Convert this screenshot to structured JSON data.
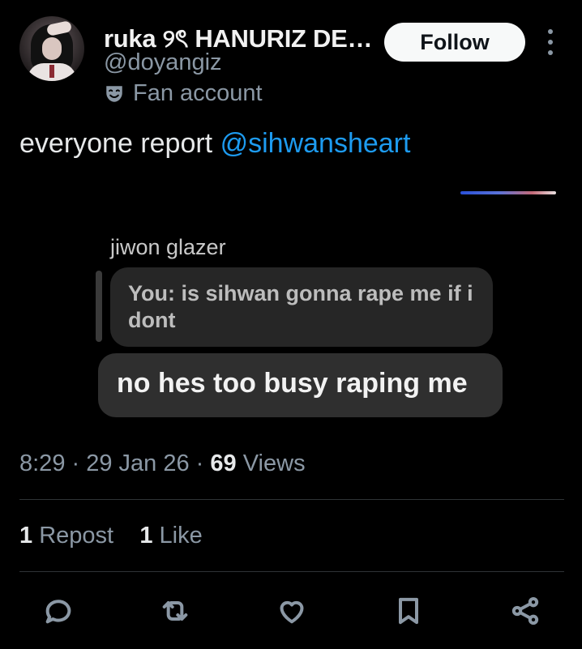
{
  "author": {
    "display_name": "ruka ୨ৎ HANURIZ DE…",
    "handle": "@doyangiz",
    "label": "Fan account"
  },
  "header": {
    "follow_label": "Follow"
  },
  "tweet": {
    "text_before": "everyone report ",
    "mention": "@sihwansheart"
  },
  "screenshot": {
    "chat_name": "jiwon glazer",
    "quoted_message": "You: is sihwan gonna rape me if i dont",
    "message": "no hes too busy raping me"
  },
  "meta": {
    "time": "8:29",
    "date": "29 Jan 26",
    "views_count": "69",
    "views_label": "Views"
  },
  "stats": {
    "reposts_count": "1",
    "reposts_label": "Repost",
    "likes_count": "1",
    "likes_label": "Like"
  },
  "actions": [
    "reply-icon",
    "repost-icon",
    "like-icon",
    "bookmark-icon",
    "share-icon"
  ],
  "colors": {
    "background": "#000000",
    "text": "#e7e9ea",
    "secondary_text": "#8b98a5",
    "link": "#1d9bf0",
    "follow_button_bg": "#f7f9f9"
  }
}
